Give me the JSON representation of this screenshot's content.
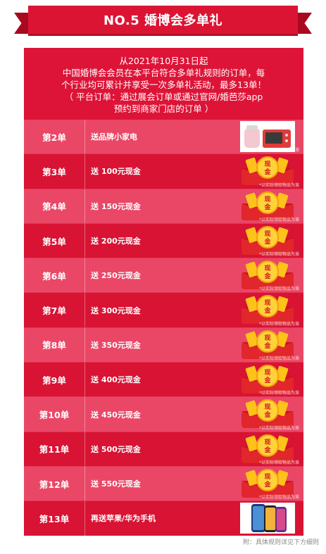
{
  "title": "NO.5 婚博会多单礼",
  "intro": {
    "line1": "从2021年10月31日起",
    "line2": "中国婚博会会员在本平台符合多单礼规则的订单，每",
    "line3": "个行业均可累计并享受一次多单礼活动，最多13单！",
    "line4": "（ 平台订单：通过展会订单或通过官网/婚芭莎app",
    "line5": "预约到商家门店的订单 ）"
  },
  "rows": [
    {
      "order": "第2单",
      "reward": "送品牌小家电",
      "icon": "appliance"
    },
    {
      "order": "第3单",
      "reward": "送 100元现金",
      "icon": "cash-envelope"
    },
    {
      "order": "第4单",
      "reward": "送 150元现金",
      "icon": "cash-envelope"
    },
    {
      "order": "第5单",
      "reward": "送 200元现金",
      "icon": "cash-envelope"
    },
    {
      "order": "第6单",
      "reward": "送 250元现金",
      "icon": "cash-envelope"
    },
    {
      "order": "第7单",
      "reward": "送 300元现金",
      "icon": "cash-envelope"
    },
    {
      "order": "第8单",
      "reward": "送 350元现金",
      "icon": "cash-envelope"
    },
    {
      "order": "第9单",
      "reward": "送 400元现金",
      "icon": "cash-envelope"
    },
    {
      "order": "第10单",
      "reward": "送 450元现金",
      "icon": "cash-envelope"
    },
    {
      "order": "第11单",
      "reward": "送 500元现金",
      "icon": "cash-envelope"
    },
    {
      "order": "第12单",
      "reward": "送 550元现金",
      "icon": "cash-envelope"
    },
    {
      "order": "第13单",
      "reward": "再送苹果/华为手机",
      "icon": "phone"
    }
  ],
  "envelope_text": "现金",
  "watermark": "*以实际领取物品为准",
  "footnote": "附：具体规则详见下方细则",
  "colors": {
    "ribbon": "#dc1434",
    "panel": "#dd1437",
    "row_pink": "#ea4766",
    "row_red": "#d81333"
  }
}
